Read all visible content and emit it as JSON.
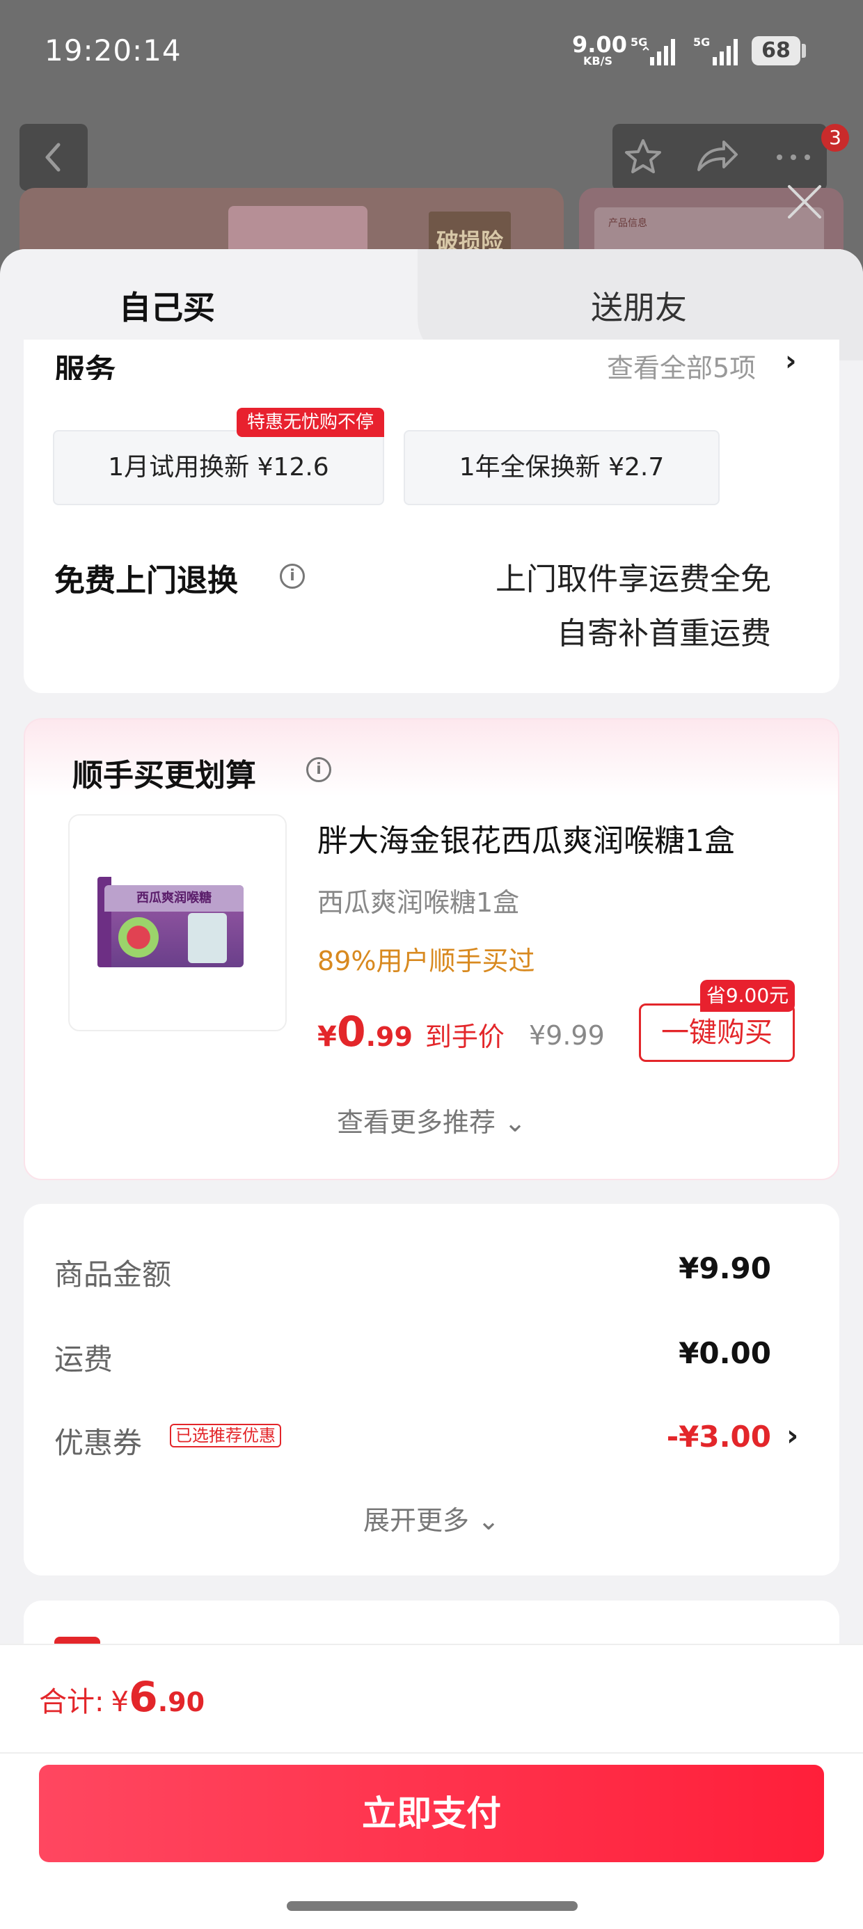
{
  "status_bar": {
    "time": "19:20:14",
    "net_speed": "9.00",
    "net_unit": "KB/S",
    "signal_label_1": "5G",
    "signal_label_2": "5G",
    "battery": "68"
  },
  "background": {
    "cart_badge": "3",
    "banner_box_text": "破损险",
    "right_card_text": "产品信息"
  },
  "tabs": {
    "self": "自己买",
    "friend": "送朋友"
  },
  "service": {
    "title": "服务",
    "more": "查看全部5项",
    "more_arrow": "›",
    "options": [
      {
        "label": "1月试用换新  ¥12.6",
        "badge": "特惠无忧购不停"
      },
      {
        "label": "1年全保换新  ¥2.7"
      }
    ],
    "return_title": "免费上门退换",
    "return_line1": "上门取件享运费全免",
    "return_line2": "自寄补首重运费"
  },
  "addon": {
    "title": "顺手买更划算",
    "product_name": "胖大海金银花西瓜爽润喉糖1盒",
    "package_text": "西瓜爽润喉糖",
    "spec": "西瓜爽润喉糖1盒",
    "popularity": "89%用户顺手买过",
    "price_currency": "¥",
    "price_int": "0",
    "price_dec": ".99",
    "price_label": "到手价",
    "original_price": "¥9.99",
    "save_badge": "省9.00元",
    "buy_button": "一键购买",
    "more": "查看更多推荐 ⌄"
  },
  "summary": {
    "rows": [
      {
        "label": "商品金额",
        "value": "¥9.90"
      },
      {
        "label": "运费",
        "value": "¥0.00"
      }
    ],
    "coupon_label": "优惠券",
    "coupon_tag": "已选推荐优惠",
    "coupon_value": "-¥3.00",
    "coupon_arrow": "›",
    "expand": "展开更多 ⌄"
  },
  "footer": {
    "total_label": "合计:",
    "total_currency": "¥",
    "total_int": "6",
    "total_dec": ".90",
    "pay_button": "立即支付"
  },
  "colors": {
    "accent_red": "#e3262a",
    "pay_gradient_start": "#ff4760",
    "pay_gradient_end": "#ff1f3a",
    "popularity_orange": "#d8891f"
  }
}
